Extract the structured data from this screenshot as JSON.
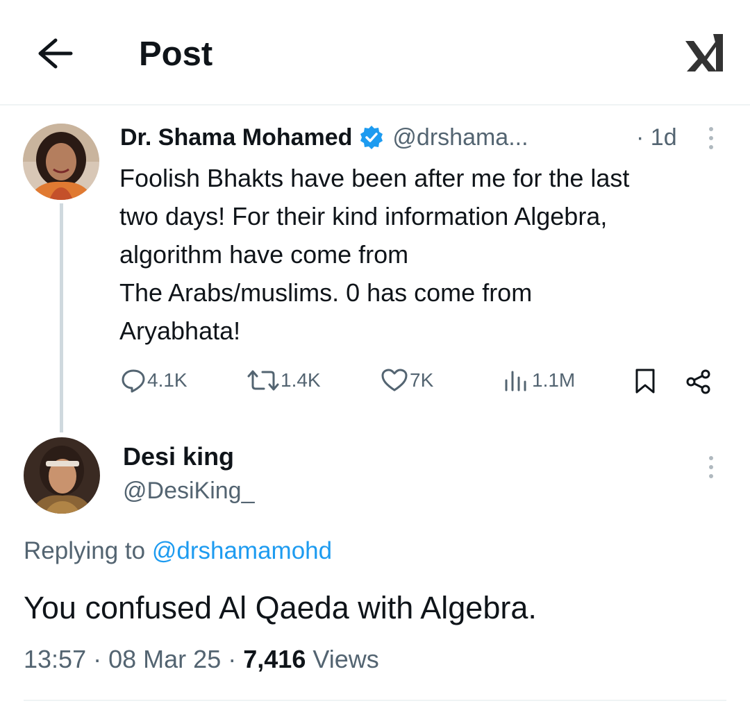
{
  "header": {
    "title": "Post"
  },
  "original_post": {
    "display_name": "Dr. Shama Mohamed",
    "handle": "@drshama...",
    "separator": "·",
    "time": "1d",
    "text_lines": [
      "Foolish Bhakts have been after me for the last",
      "two days! For their kind information Algebra,",
      "algorithm have come from",
      "The Arabs/muslims. 0 has come from",
      "Aryabhata!"
    ],
    "stats": {
      "replies": "4.1K",
      "reposts": "1.4K",
      "likes": "7K",
      "views": "1.1M"
    }
  },
  "reply_post": {
    "display_name": "Desi king",
    "handle": "@DesiKing_",
    "replying_prefix": "Replying to",
    "replying_handle": "@drshamamohd",
    "text": "You confused Al Qaeda with Algebra.",
    "time": "13:57",
    "date": "08 Mar 25",
    "views_count": "7,416",
    "views_label": "Views",
    "separator": "·"
  },
  "colors": {
    "accent": "#1d9bf0",
    "text": "#0f1419",
    "secondary": "#536471",
    "divider": "#eff3f4"
  },
  "icons": [
    "back-arrow-icon",
    "x-logo-icon",
    "verified-badge-icon",
    "more-options-icon",
    "reply-icon",
    "repost-icon",
    "like-icon",
    "views-icon",
    "bookmark-icon",
    "share-icon"
  ]
}
